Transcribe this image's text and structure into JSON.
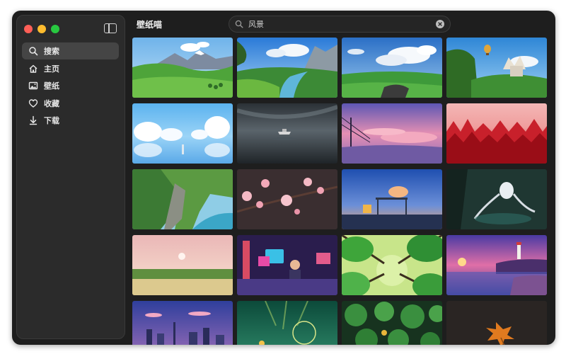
{
  "app": {
    "title": "壁纸喵"
  },
  "search": {
    "value": "风景",
    "placeholder": ""
  },
  "sidebar": {
    "items": [
      {
        "label": "搜索",
        "icon": "search-icon",
        "active": true
      },
      {
        "label": "主页",
        "icon": "home-icon",
        "active": false
      },
      {
        "label": "壁纸",
        "icon": "image-icon",
        "active": false
      },
      {
        "label": "收藏",
        "icon": "heart-icon",
        "active": false
      },
      {
        "label": "下载",
        "icon": "download-icon",
        "active": false
      }
    ]
  },
  "wallpapers": [
    {
      "subject": "green meadow with snowy mountains"
    },
    {
      "subject": "anime river valley with mountains"
    },
    {
      "subject": "sky with clouds over green plains"
    },
    {
      "subject": "hot air balloon over hillside castle"
    },
    {
      "subject": "white clouds reflected on blue water"
    },
    {
      "subject": "boat on calm grey lake"
    },
    {
      "subject": "pink sunset with power lines"
    },
    {
      "subject": "red forest under pink sky"
    },
    {
      "subject": "green cliffs by the sea"
    },
    {
      "subject": "pink cherry blossoms"
    },
    {
      "subject": "bus stop by the sea at dusk"
    },
    {
      "subject": "white spirit creature in dark forest"
    },
    {
      "subject": "pink sky over grass field with moon"
    },
    {
      "subject": "girl in neon retro room"
    },
    {
      "subject": "looking up at green trees"
    },
    {
      "subject": "lighthouse at purple sunset"
    },
    {
      "subject": "city skyline at dusk"
    },
    {
      "subject": "underwater green scene with jellyfish"
    },
    {
      "subject": "green lily pads"
    },
    {
      "subject": "orange maple leaf on dark water"
    }
  ],
  "colors": {
    "window_bg": "#1e1e1e",
    "sidebar_bg": "#2b2b2b",
    "active_item": "#454545",
    "traffic_red": "#ff5f57",
    "traffic_yellow": "#febc2e",
    "traffic_green": "#28c840"
  }
}
